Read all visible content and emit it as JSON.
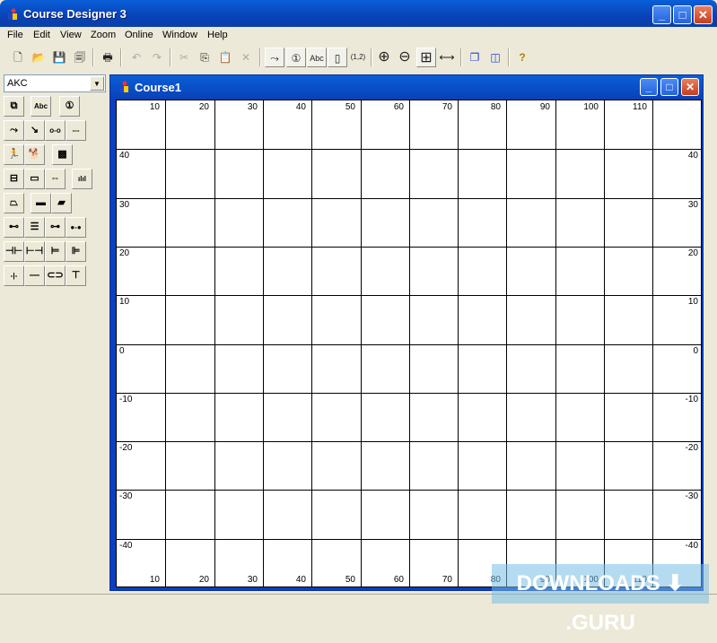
{
  "app": {
    "title": "Course Designer 3"
  },
  "menu": [
    "File",
    "Edit",
    "View",
    "Zoom",
    "Online",
    "Window",
    "Help"
  ],
  "toolbar": {
    "buttons": [
      {
        "name": "new",
        "glyph": "🗋"
      },
      {
        "name": "open",
        "glyph": "📂"
      },
      {
        "name": "save",
        "glyph": "💾"
      },
      {
        "name": "save-all",
        "glyph": "🗐"
      },
      {
        "name": "print",
        "glyph": "🖶"
      },
      {
        "name": "undo",
        "glyph": "↶"
      },
      {
        "name": "redo",
        "glyph": "↷"
      },
      {
        "name": "cut",
        "glyph": "✂"
      },
      {
        "name": "copy",
        "glyph": "⎘"
      },
      {
        "name": "paste",
        "glyph": "📋"
      },
      {
        "name": "delete",
        "glyph": "✕"
      },
      {
        "name": "path",
        "glyph": "⤳"
      },
      {
        "name": "number",
        "glyph": "①"
      },
      {
        "name": "label",
        "glyph": "Abc"
      },
      {
        "name": "page",
        "glyph": "▯"
      },
      {
        "name": "coordinates",
        "glyph": "(1,2)"
      },
      {
        "name": "zoom-in",
        "glyph": "⊕"
      },
      {
        "name": "zoom-out",
        "glyph": "⊖"
      },
      {
        "name": "fit",
        "glyph": "⊞"
      },
      {
        "name": "fit-width",
        "glyph": "⟷"
      },
      {
        "name": "cascade",
        "glyph": "❐"
      },
      {
        "name": "tile",
        "glyph": "◫"
      },
      {
        "name": "help",
        "glyph": "?"
      }
    ]
  },
  "organization": {
    "selected": "AKC"
  },
  "tools": [
    [
      "⧉",
      "Abc",
      "①"
    ],
    [
      "⤳",
      "↘",
      "o-o",
      "---"
    ],
    [
      "🏃",
      "🐕",
      "▩"
    ],
    [
      "⊟",
      "▭",
      "⇔",
      "ılıl"
    ],
    [
      "⏢",
      "▬",
      "▰"
    ],
    [
      "⊷",
      "☰",
      "⊶",
      "●-●"
    ],
    [
      "⊣⊢",
      "⊢⊣",
      "⊨",
      "⊫"
    ],
    [
      "-|-",
      "—",
      "⊂⊃",
      "⊤"
    ]
  ],
  "course": {
    "title": "Course1",
    "x_labels": [
      "10",
      "20",
      "30",
      "40",
      "50",
      "60",
      "70",
      "80",
      "90",
      "100",
      "110"
    ],
    "y_labels": [
      "40",
      "30",
      "20",
      "10",
      "0",
      "-10",
      "-20",
      "-30",
      "-40"
    ]
  },
  "watermark": "DOWNLOADS ⬇ .GURU"
}
